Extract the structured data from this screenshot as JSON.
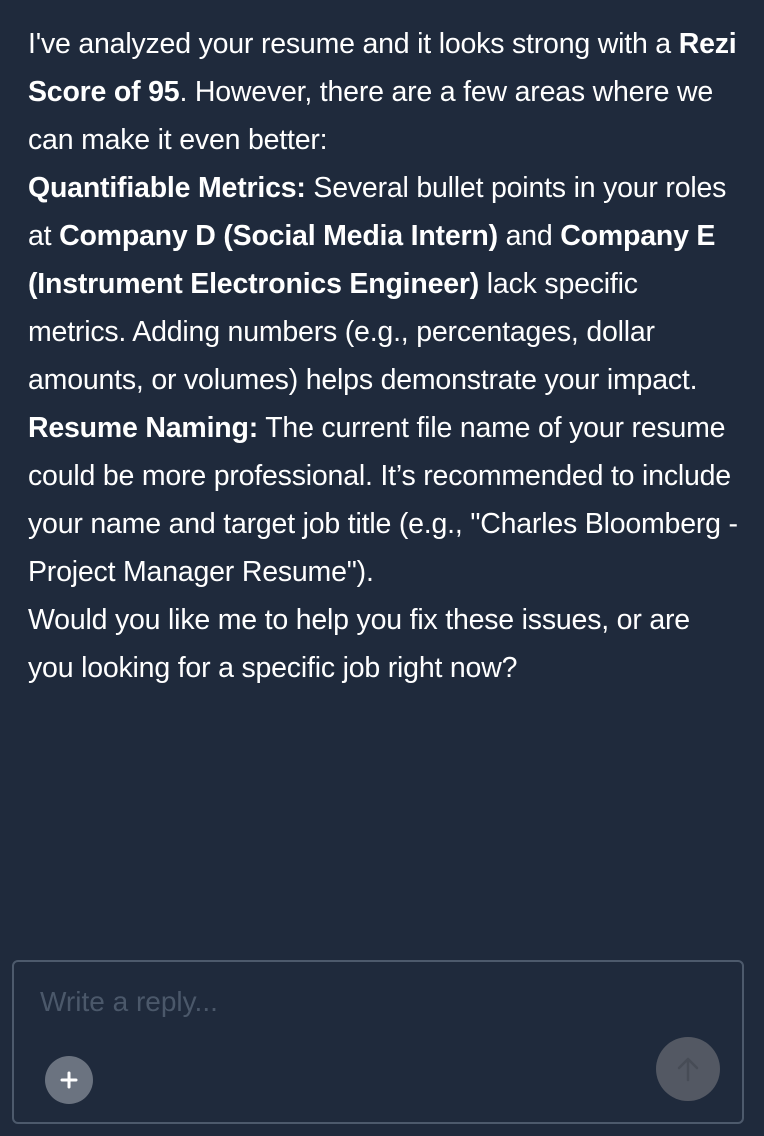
{
  "message": {
    "intro": {
      "t1": "I've analyzed your resume and it looks strong with a ",
      "b1": "Rezi Score of 95",
      "t2": ". However, there are a few areas where we can make it even better:"
    },
    "metrics": {
      "heading": "Quantifiable Metrics:",
      "t1": " Several bullet points in your roles at ",
      "b1": "Company D (Social Media Intern)",
      "t2": " and ",
      "b2": "Company E (Instrument Electronics Engineer)",
      "t3": " lack specific metrics. Adding numbers (e.g., percentages, dollar amounts, or volumes) helps demonstrate your impact."
    },
    "naming": {
      "heading": "Resume Naming:",
      "t1": " The current file name of your resume could be more professional. It’s recommended to include your name and target job title (e.g., \"Charles Bloomberg - Project Manager Resume\")."
    },
    "closing": "Would you like me to help you fix these issues, or are you looking for a specific job right now?"
  },
  "composer": {
    "placeholder": "Write a reply...",
    "add_icon": "plus-icon",
    "send_icon": "arrow-up-icon"
  },
  "colors": {
    "background": "#1f2a3c",
    "text": "#ffffff",
    "border": "#4d5a6c",
    "add_button": "#6b7380",
    "send_button": "#535863"
  }
}
